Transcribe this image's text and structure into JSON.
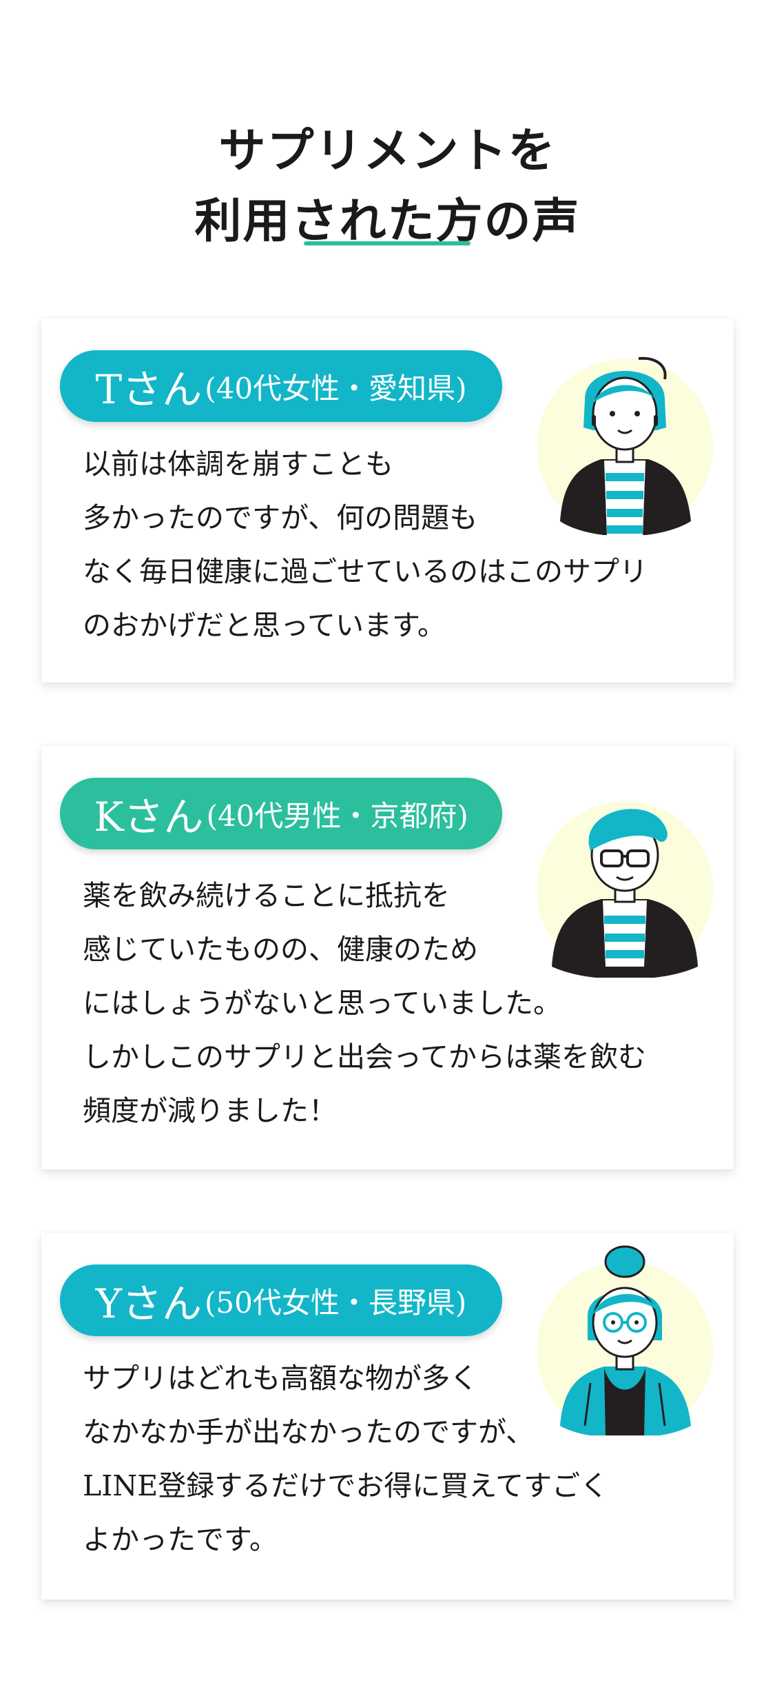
{
  "heading": {
    "line1": "サプリメントを",
    "line2": "利用された方の声"
  },
  "colors": {
    "accent": "#2bbf9d",
    "badge_teal": "#12b6c8",
    "badge_green": "#2bbf9d",
    "avatar_bg": "#fbfddd"
  },
  "testimonials": [
    {
      "name": "Tさん",
      "meta": "(40代女性・愛知県)",
      "avatar_icon": "woman-avatar-icon",
      "lines": [
        "以前は体調を崩すことも",
        "多かったのですが、何の問題も",
        "なく毎日健康に過ごせているのはこのサプリ",
        "のおかげだと思っています。"
      ]
    },
    {
      "name": "Kさん",
      "meta": "(40代男性・京都府)",
      "avatar_icon": "man-with-glasses-avatar-icon",
      "lines": [
        "薬を飲み続けることに抵抗を",
        "感じていたものの、健康のため",
        "にはしょうがないと思っていました。",
        "しかしこのサプリと出会ってからは薬を飲む",
        "頻度が減りました！"
      ]
    },
    {
      "name": "Yさん",
      "meta": "(50代女性・長野県)",
      "avatar_icon": "woman-with-glasses-avatar-icon",
      "lines": [
        "サプリはどれも高額な物が多く",
        "なかなか手が出なかったのですが、",
        "LINE登録するだけでお得に買えてすごく",
        "よかったです。"
      ]
    }
  ]
}
